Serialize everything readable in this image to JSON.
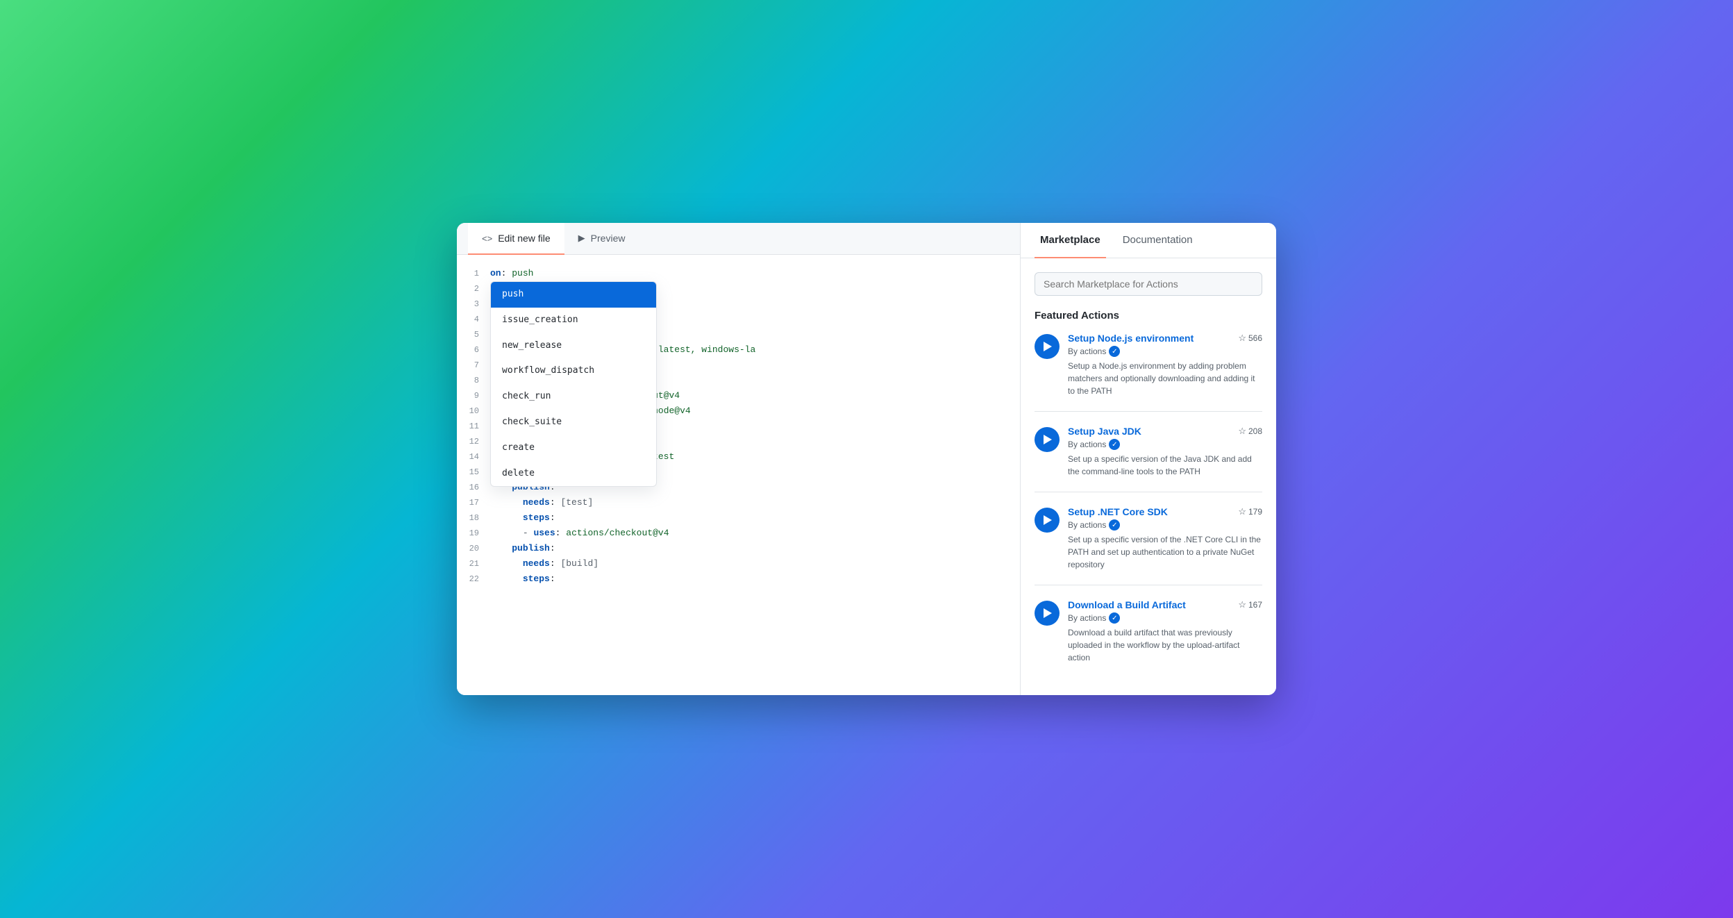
{
  "editor": {
    "tab_edit_label": "Edit new file",
    "tab_preview_label": "Preview",
    "code_lines": [
      {
        "num": 1,
        "type": "on_push"
      },
      {
        "num": 2,
        "type": "jobs"
      },
      {
        "num": 3,
        "type": "test_indent"
      },
      {
        "num": 4,
        "type": "empty"
      },
      {
        "num": 5,
        "type": "empty"
      },
      {
        "num": 6,
        "type": "runs_on"
      },
      {
        "num": 7,
        "type": "platform"
      },
      {
        "num": 8,
        "type": "empty"
      },
      {
        "num": 9,
        "type": "checkout"
      },
      {
        "num": 10,
        "type": "setup_node"
      },
      {
        "num": 11,
        "type": "with"
      },
      {
        "num": 12,
        "type": "version"
      },
      {
        "num": 14,
        "type": "npm_run"
      },
      {
        "num": 15,
        "type": "uses_blank"
      },
      {
        "num": 16,
        "type": "publish"
      },
      {
        "num": 17,
        "type": "needs_test"
      },
      {
        "num": 18,
        "type": "steps"
      },
      {
        "num": 19,
        "type": "checkout2"
      },
      {
        "num": 20,
        "type": "publish2"
      },
      {
        "num": 21,
        "type": "needs_build"
      },
      {
        "num": 22,
        "type": "steps2"
      }
    ]
  },
  "autocomplete": {
    "items": [
      {
        "label": "push",
        "selected": true
      },
      {
        "label": "issue_creation",
        "selected": false
      },
      {
        "label": "new_release",
        "selected": false
      },
      {
        "label": "workflow_dispatch",
        "selected": false
      },
      {
        "label": "check_run",
        "selected": false
      },
      {
        "label": "check_suite",
        "selected": false
      },
      {
        "label": "create",
        "selected": false
      },
      {
        "label": "delete",
        "selected": false
      }
    ]
  },
  "marketplace": {
    "tab_marketplace": "Marketplace",
    "tab_documentation": "Documentation",
    "search_placeholder": "Search Marketplace for Actions",
    "featured_title": "Featured Actions",
    "actions": [
      {
        "name": "Setup Node.js environment",
        "by": "By actions",
        "verified": true,
        "stars": 566,
        "description": "Setup a Node.js environment by adding problem matchers and optionally downloading and adding it to the PATH"
      },
      {
        "name": "Setup Java JDK",
        "by": "By actions",
        "verified": true,
        "stars": 208,
        "description": "Set up a specific version of the Java JDK and add the command-line tools to the PATH"
      },
      {
        "name": "Setup .NET Core SDK",
        "by": "By actions",
        "verified": true,
        "stars": 179,
        "description": "Set up a specific version of the .NET Core CLI in the PATH and set up authentication to a private NuGet repository"
      },
      {
        "name": "Download a Build Artifact",
        "by": "By actions",
        "verified": true,
        "stars": 167,
        "description": "Download a build artifact that was previously uploaded in the workflow by the upload-artifact action"
      }
    ]
  }
}
